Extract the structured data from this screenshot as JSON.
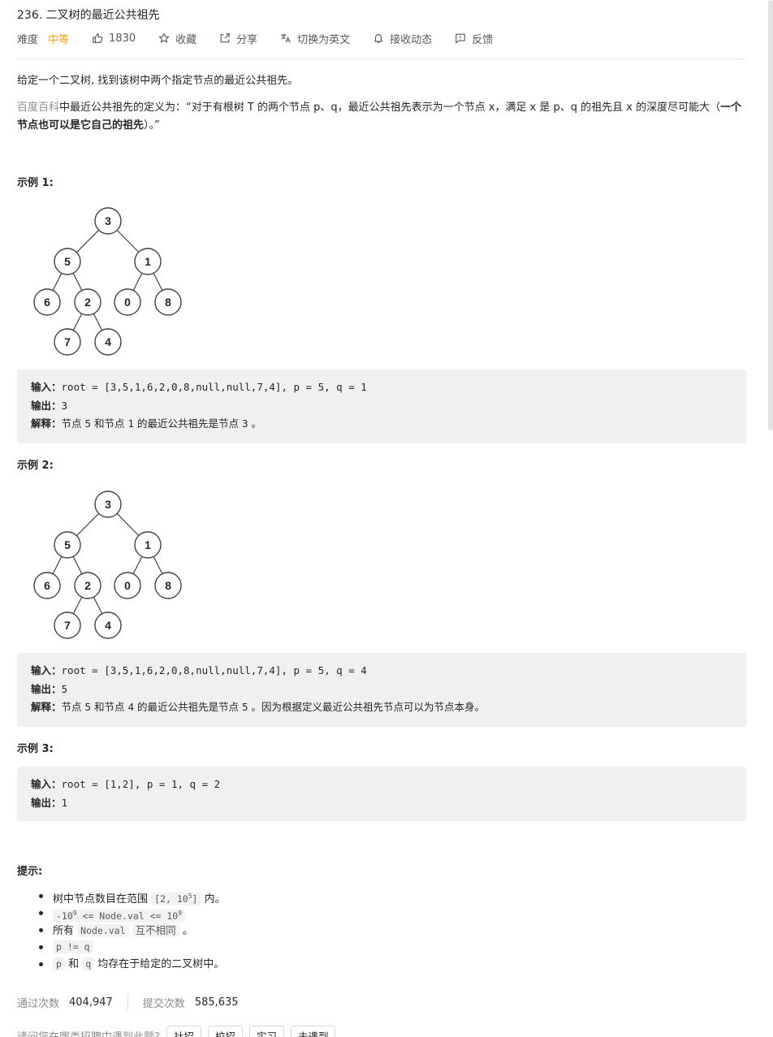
{
  "problem": {
    "title": "236. 二叉树的最近公共祖先",
    "difficulty_label": "难度",
    "difficulty_value": "中等",
    "likes": "1830",
    "favorite_label": "收藏",
    "share_label": "分享",
    "switch_lang_label": "切换为英文",
    "subscribe_label": "接收动态",
    "feedback_label": "反馈"
  },
  "description": {
    "line1": "给定一个二叉树, 找到该树中两个指定节点的最近公共祖先。",
    "link_text": "百度百科",
    "def_part1": "中最近公共祖先的定义为：“对于有根树 T 的两个节点 p、q，最近公共祖先表示为一个节点 x，满足 x 是 p、q 的祖先且 x 的深度尽可能大（",
    "def_bold": "一个节点也可以是它自己的祖先",
    "def_part2": "）。”"
  },
  "examples": [
    {
      "heading": "示例 1:",
      "tree_nodes": [
        "3",
        "5",
        "1",
        "6",
        "2",
        "0",
        "8",
        "7",
        "4"
      ],
      "input_label": "输入：",
      "input_value": "root = [3,5,1,6,2,0,8,null,null,7,4], p = 5, q = 1",
      "output_label": "输出：",
      "output_value": "3",
      "explain_label": "解释：",
      "explain_parts": [
        "节点 ",
        "5",
        " 和节点 ",
        "1",
        " 的最近公共祖先是节点 ",
        "3",
        " 。"
      ]
    },
    {
      "heading": "示例 2:",
      "tree_nodes": [
        "3",
        "5",
        "1",
        "6",
        "2",
        "0",
        "8",
        "7",
        "4"
      ],
      "input_label": "输入：",
      "input_value": "root = [3,5,1,6,2,0,8,null,null,7,4], p = 5, q = 4",
      "output_label": "输出：",
      "output_value": "5",
      "explain_label": "解释：",
      "explain_parts": [
        "节点 ",
        "5",
        " 和节点 ",
        "4",
        " 的最近公共祖先是节点 ",
        "5",
        " 。因为根据定义最近公共祖先节点可以为节点本身。"
      ]
    },
    {
      "heading": "示例 3:",
      "input_label": "输入：",
      "input_value": "root = [1,2], p = 1, q = 2",
      "output_label": "输出：",
      "output_value": "1"
    }
  ],
  "hints": {
    "heading": "提示:",
    "h1_pre": "树中节点数目在范围 ",
    "h1_code": "[2, 10",
    "h1_sup": "5",
    "h1_code_end": "]",
    "h1_post": " 内。",
    "h2_code_a": "-10",
    "h2_sup_a": "9",
    "h2_code_b": " <= Node.val <= 10",
    "h2_sup_b": "9",
    "h3_pre": "所有 ",
    "h3_code": "Node.val",
    "h3_code2": "互不相同",
    "h3_post": " 。",
    "h4_code": "p != q",
    "h5_code_p": "p",
    "h5_mid": " 和 ",
    "h5_code_q": "q",
    "h5_post": " 均存在于给定的二叉树中。"
  },
  "stats": {
    "accepted_label": "通过次数",
    "accepted_value": "404,947",
    "submitted_label": "提交次数",
    "submitted_value": "585,635"
  },
  "interview": {
    "question": "请问您在哪类招聘中遇到此题?",
    "options": [
      "社招",
      "校招",
      "实习",
      "未遇到"
    ]
  }
}
